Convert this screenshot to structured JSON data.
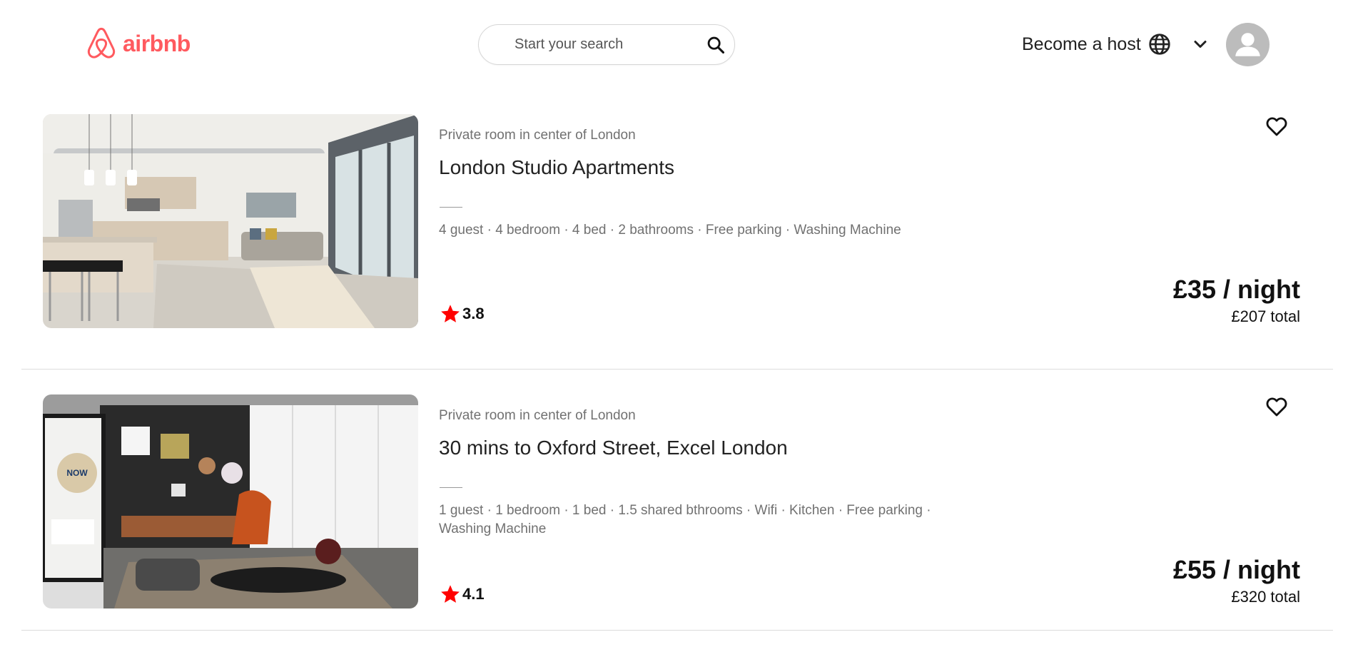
{
  "brand": {
    "name": "airbnb",
    "color": "#ff5a5f"
  },
  "search": {
    "placeholder": "Start your search",
    "icon": "search-icon"
  },
  "header": {
    "host_label": "Become a host",
    "language_icon": "globe-icon",
    "menu_icon": "chevron-down-icon",
    "avatar_icon": "user-avatar-icon"
  },
  "listings": [
    {
      "subtitle": "Private room in center of London",
      "title": "London Studio Apartments",
      "amenities": "4 guest · 4 bedroom · 4 bed · 2 bathrooms · Free parking · Washing Machine",
      "rating": "3.8",
      "price_per_night": "£35 / night",
      "price_total": "£207 total",
      "photo": "modern-studio-kitchen-living-room-photo"
    },
    {
      "subtitle": "Private room in center of London",
      "title": "30 mins to Oxford Street, Excel London",
      "amenities": "1 guest · 1 bedroom · 1 bed · 1.5 shared bthrooms · Wifi · Kitchen · Free parking · Washing Machine",
      "rating": "4.1",
      "price_per_night": "£55 / night",
      "price_total": "£320 total",
      "photo": "living-room-orange-chair-photo"
    }
  ],
  "colors": {
    "star": "#ff0000",
    "muted_text": "#717171",
    "divider": "#dcdcdc"
  }
}
